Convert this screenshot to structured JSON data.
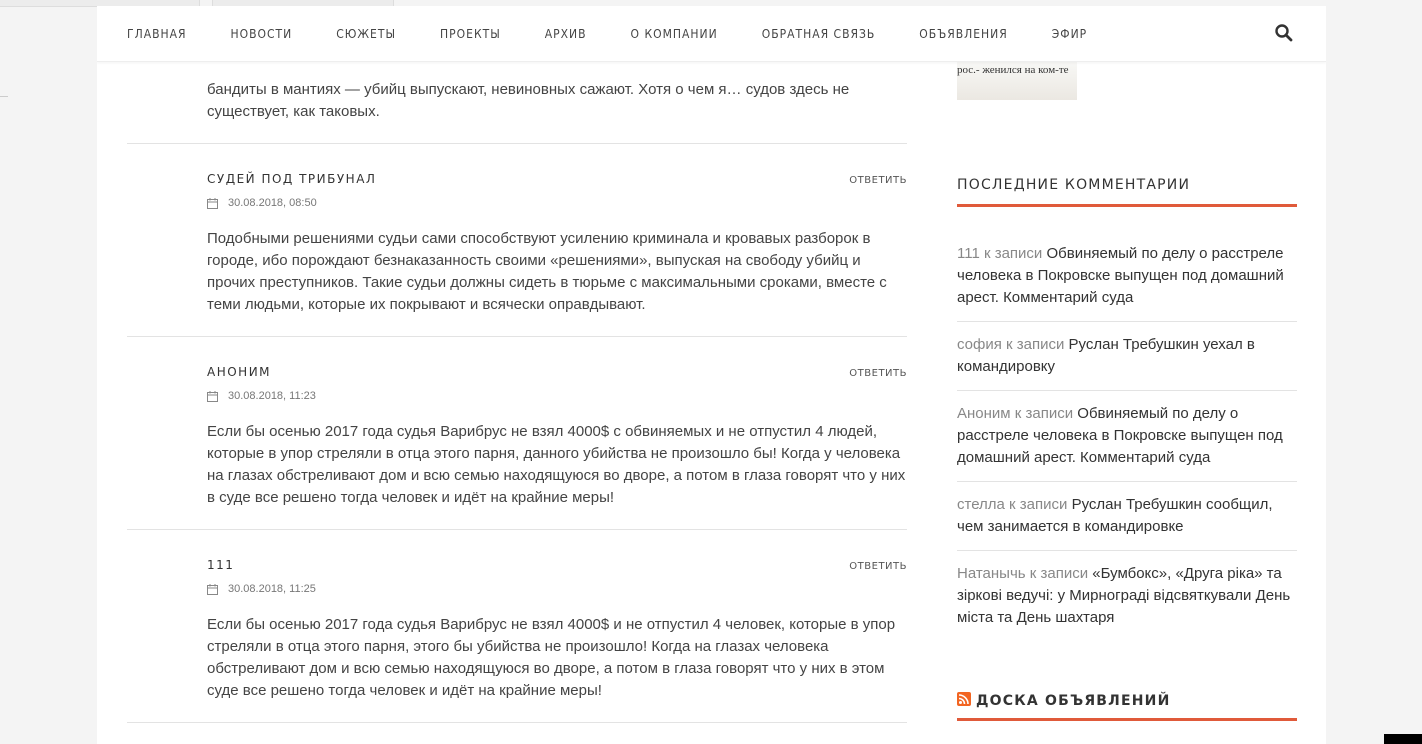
{
  "nav": {
    "items": [
      "ГЛАВНАЯ",
      "НОВОСТИ",
      "СЮЖЕТЫ",
      "ПРОЕКТЫ",
      "АРХИВ",
      "О КОМПАНИИ",
      "ОБРАТНАЯ СВЯЗЬ",
      "ОБЪЯВЛЕНИЯ",
      "ЭФИР"
    ]
  },
  "comments": {
    "top_text": "бандиты в мантиях — убийц выпускают, невиновных сажают. Хотя о чем я… судов здесь не существует, как таковых.",
    "reply_label": "ОТВЕТИТЬ",
    "items": [
      {
        "author": "СУДЕЙ ПОД ТРИБУНАЛ",
        "date": "30.08.2018, 08:50",
        "text": "Подобными решениями судьи сами способствуют усилению криминала и кровавых разборок в городе, ибо порождают безнаказанность своими «решениями», выпуская на свободу убийц и прочих преступников. Такие судьи должны сидеть в тюрьме с максимальными сроками, вместе с теми людьми, которые их покрывают и всячески оправдывают."
      },
      {
        "author": "АНОНИМ",
        "date": "30.08.2018, 11:23",
        "text": "Если бы осенью 2017 года судья Варибрус не взял 4000$ с обвиняемых и не отпустил 4 людей, которые в упор стреляли в отца этого парня, данного убийства не произошло бы! Когда у человека на глазах обстреливают дом и всю семью находящуюся во дворе, а потом в глаза говорят что у них в суде все решено тогда человек и идёт на крайние меры!"
      },
      {
        "author": "111",
        "date": "30.08.2018, 11:25",
        "text": "Если бы осенью 2017 года судья Варибрус не взял 4000$ и не отпустил 4 человек, которые в упор стреляли в отца этого парня, этого бы убийства не произошло! Когда на глазах человека обстреливают дом и всю семью находящуюся во дворе, а потом в глаза говорят что у них в этом суде все решено тогда человек и идёт на крайние меры!"
      }
    ]
  },
  "sidebar": {
    "thumb_text": "рос.- женился на ком-те",
    "recent_title": "ПОСЛЕДНИЕ КОММЕНТАРИИ",
    "recent": [
      {
        "author": "111 к записи",
        "link": "Обвиняемый по делу о расстреле человека в Покровске выпущен под домашний арест. Комментарий суда"
      },
      {
        "author": "софия к записи",
        "link": "Руслан Требушкин уехал в командировку"
      },
      {
        "author": "Аноним к записи",
        "link": "Обвиняемый по делу о расстреле человека в Покровске выпущен под домашний арест. Комментарий суда"
      },
      {
        "author": "стелла к записи",
        "link": "Руслан Требушкин сообщил, чем занимается в командировке"
      },
      {
        "author": "Натанычь к записи",
        "link": "«Бумбокс», «Друга ріка» та зіркові ведучі: у Мирнограді відсвяткували День міста та День шахтаря"
      }
    ],
    "ads_title": "ДОСКА ОБЪЯВЛЕНИЙ"
  },
  "colors": {
    "accent": "#e05a3a",
    "rss": "#f26522"
  }
}
